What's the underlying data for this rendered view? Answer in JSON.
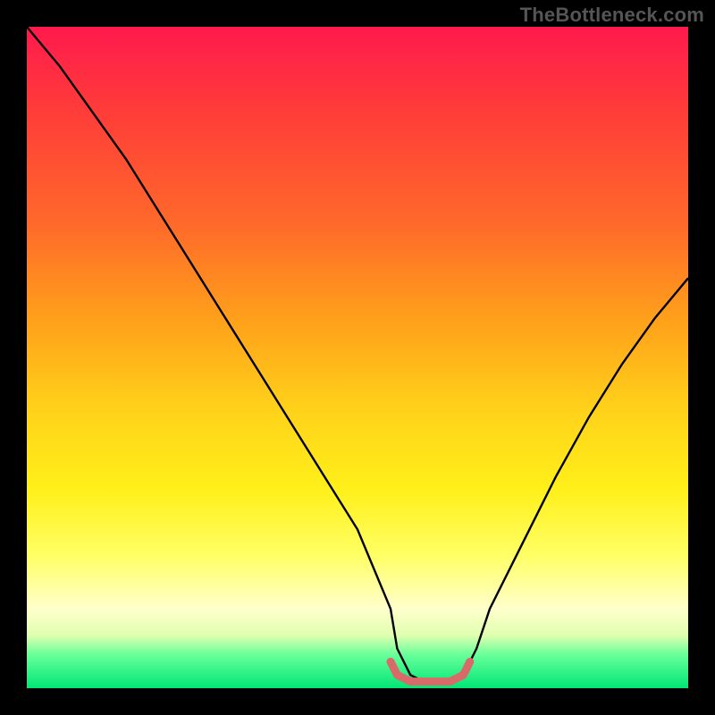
{
  "watermark": "TheBottleneck.com",
  "chart_data": {
    "type": "line",
    "title": "",
    "xlabel": "",
    "ylabel": "",
    "xlim": [
      0,
      100
    ],
    "ylim": [
      0,
      100
    ],
    "series": [
      {
        "name": "bottleneck-curve",
        "x": [
          0,
          5,
          10,
          15,
          20,
          25,
          30,
          35,
          40,
          45,
          50,
          55,
          56,
          58,
          60,
          62,
          64,
          66,
          68,
          70,
          75,
          80,
          85,
          90,
          95,
          100
        ],
        "values": [
          100,
          94,
          87,
          80,
          72,
          64,
          56,
          48,
          40,
          32,
          24,
          12,
          6,
          2,
          1,
          1,
          1,
          2,
          6,
          12,
          22,
          32,
          41,
          49,
          56,
          62
        ]
      },
      {
        "name": "optimal-range-marker",
        "x": [
          55,
          56,
          58,
          60,
          62,
          64,
          66,
          67
        ],
        "values": [
          4,
          2,
          1,
          1,
          1,
          1,
          2,
          4
        ]
      }
    ],
    "gradient": {
      "orientation": "vertical",
      "stops": [
        {
          "pos": 0.0,
          "color": "#ff1a4d"
        },
        {
          "pos": 0.12,
          "color": "#ff3a3a"
        },
        {
          "pos": 0.3,
          "color": "#ff6a2a"
        },
        {
          "pos": 0.45,
          "color": "#ffa31a"
        },
        {
          "pos": 0.58,
          "color": "#ffd21a"
        },
        {
          "pos": 0.7,
          "color": "#fff01a"
        },
        {
          "pos": 0.8,
          "color": "#ffff66"
        },
        {
          "pos": 0.88,
          "color": "#ffffcc"
        },
        {
          "pos": 0.92,
          "color": "#e0ffb0"
        },
        {
          "pos": 0.95,
          "color": "#66ff99"
        },
        {
          "pos": 1.0,
          "color": "#00e676"
        }
      ]
    },
    "curve_color": "#000000",
    "marker_color": "#d96a6a"
  }
}
